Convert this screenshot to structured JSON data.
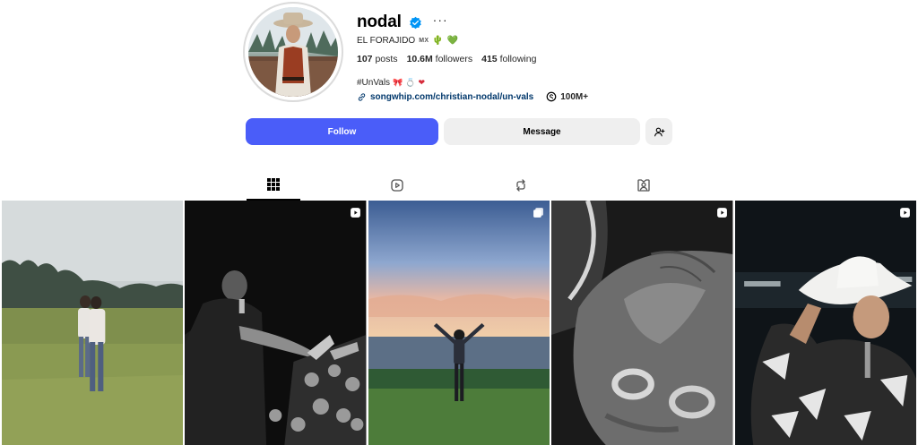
{
  "profile": {
    "username": "nodal",
    "fullname": "EL FORAJIDO",
    "flag_text": "MX",
    "posts_count": "107",
    "posts_label": "posts",
    "followers_count": "10.6M",
    "followers_label": "followers",
    "following_count": "415",
    "following_label": "following",
    "bio": "#UnVals",
    "link": "songwhip.com/christian-nodal/un-vals",
    "threads_count": "100M+"
  },
  "actions": {
    "follow_label": "Follow",
    "message_label": "Message"
  },
  "tabs": [
    {
      "name": "posts",
      "icon": "grid-icon",
      "active": true
    },
    {
      "name": "reels",
      "icon": "reels-icon",
      "active": false
    },
    {
      "name": "reposts",
      "icon": "repost-icon",
      "active": false
    },
    {
      "name": "tagged",
      "icon": "tagged-icon",
      "active": false
    }
  ],
  "posts": [
    {
      "scene": "field-couple",
      "badge": "none"
    },
    {
      "scene": "concert-bw",
      "badge": "reel-icon"
    },
    {
      "scene": "ocean-sunset",
      "badge": "carousel-icon"
    },
    {
      "scene": "hand-rings-bw",
      "badge": "reel-icon"
    },
    {
      "scene": "cowboy-hat",
      "badge": "reel-icon"
    }
  ],
  "colors": {
    "follow_button": "#4a5df9",
    "secondary_button": "#efefef",
    "link": "#00376b",
    "verified": "#0095f6"
  }
}
